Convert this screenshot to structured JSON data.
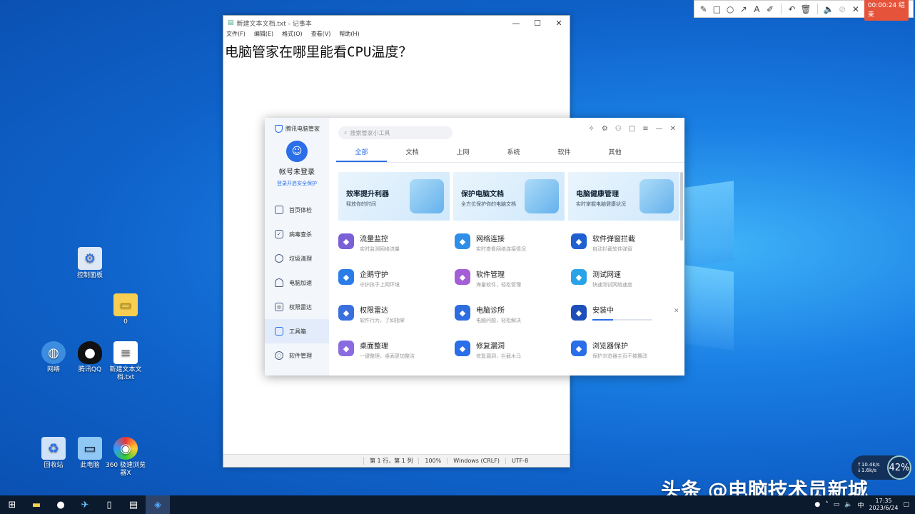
{
  "desktop": {
    "icons": [
      {
        "label": "控制面板",
        "icon": "control-panel-icon"
      },
      {
        "label": "0",
        "icon": "folder-icon"
      },
      {
        "label": "网络",
        "icon": "network-icon"
      },
      {
        "label": "腾讯QQ",
        "icon": "qq-icon"
      },
      {
        "label": "新建文本文档.txt",
        "icon": "text-file-icon"
      },
      {
        "label": "回收站",
        "icon": "recycle-bin-icon"
      },
      {
        "label": "此电脑",
        "icon": "this-pc-icon"
      },
      {
        "label": "360 极速浏览器X",
        "icon": "browser-360-icon"
      }
    ]
  },
  "annotation_toolbar": {
    "timer": "00:00:24 结束"
  },
  "notepad": {
    "title": "新建文本文档.txt - 记事本",
    "menu": [
      "文件(F)",
      "编辑(E)",
      "格式(O)",
      "查看(V)",
      "帮助(H)"
    ],
    "content": "电脑管家在哪里能看CPU温度？",
    "status": {
      "position": "第 1 行，第 1 列",
      "zoom": "100%",
      "eol": "Windows (CRLF)",
      "encoding": "UTF-8"
    }
  },
  "manager": {
    "app_name": "腾讯电脑管家",
    "account": {
      "name": "帐号未登录",
      "hint": "登录开启安全保护"
    },
    "nav": [
      {
        "label": "首页体检",
        "icon": "home-check-icon"
      },
      {
        "label": "病毒查杀",
        "icon": "virus-scan-icon"
      },
      {
        "label": "垃圾清理",
        "icon": "trash-clean-icon"
      },
      {
        "label": "电脑加速",
        "icon": "speedup-icon"
      },
      {
        "label": "权限雷达",
        "icon": "radar-icon"
      },
      {
        "label": "工具箱",
        "icon": "toolbox-icon"
      },
      {
        "label": "软件管理",
        "icon": "software-icon"
      }
    ],
    "active_nav": "工具箱",
    "search_placeholder": "搜索管家小工具",
    "tabs": [
      "全部",
      "文档",
      "上网",
      "系统",
      "软件",
      "其他"
    ],
    "active_tab": "全部",
    "banners": [
      {
        "title": "效率提升利器",
        "subtitle": "释放你的时间"
      },
      {
        "title": "保护电脑文档",
        "subtitle": "全方位保护你的电脑文档"
      },
      {
        "title": "电脑健康管理",
        "subtitle": "实时掌握电脑健康状况"
      }
    ],
    "tools": [
      {
        "name": "流量监控",
        "desc": "实时监测网络流量",
        "color": "#7b5fd6",
        "icon": "traffic-monitor-icon"
      },
      {
        "name": "网络连接",
        "desc": "实时查看网络连接情况",
        "color": "#2f8fe8",
        "icon": "network-connect-icon"
      },
      {
        "name": "软件弹窗拦截",
        "desc": "自动拦截软件弹窗",
        "color": "#1f5fcf",
        "icon": "popup-block-icon"
      },
      {
        "name": "企鹅守护",
        "desc": "守护孩子上网环境",
        "color": "#2a7de8",
        "icon": "penguin-guard-icon"
      },
      {
        "name": "软件管理",
        "desc": "海量软件，轻松管理",
        "color": "#a45fd6",
        "icon": "software-manage-icon"
      },
      {
        "name": "测试网速",
        "desc": "快速测试网络速度",
        "color": "#29a3e8",
        "icon": "speed-test-icon"
      },
      {
        "name": "权限雷达",
        "desc": "软件行为，了如指掌",
        "color": "#3a6fe0",
        "icon": "permission-radar-icon"
      },
      {
        "name": "电脑诊所",
        "desc": "电脑问题，轻松解决",
        "color": "#2d6de0",
        "icon": "pc-clinic-icon"
      },
      {
        "name": "安装中",
        "desc": "",
        "color": "#1d4fb8",
        "icon": "installing-icon",
        "progress": 0.35
      },
      {
        "name": "桌面整理",
        "desc": "一键整理，桌面更加整洁",
        "color": "#8a6be0",
        "icon": "desktop-organize-icon"
      },
      {
        "name": "修复漏洞",
        "desc": "修复漏洞，拦截木马",
        "color": "#2a6ee8",
        "icon": "fix-vuln-icon"
      },
      {
        "name": "浏览器保护",
        "desc": "保护浏览器主页不被篡改",
        "color": "#2a6ee8",
        "icon": "browser-protect-icon"
      }
    ]
  },
  "speed_widget": {
    "up": "↑10.4k/s",
    "down": "↓1.6k/s",
    "percent": "42%"
  },
  "watermark": "头条 @电脑技术员新城",
  "clock": {
    "time": "17:35",
    "date": "2023/6/24"
  }
}
